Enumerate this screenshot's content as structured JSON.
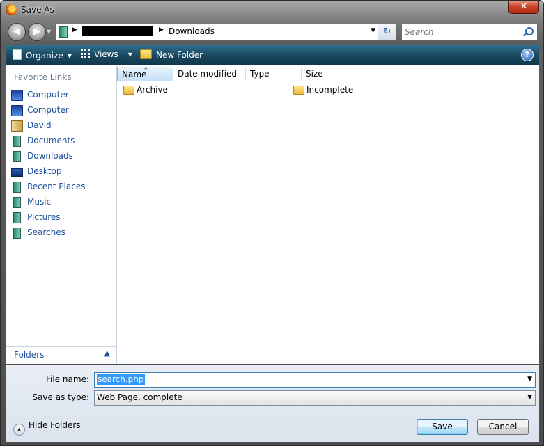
{
  "window": {
    "title": "Save As",
    "close_glyph": "✕"
  },
  "address_bar": {
    "current_folder": "Downloads"
  },
  "search": {
    "placeholder": "Search"
  },
  "toolbar": {
    "organize": "Organize",
    "views": "Views",
    "new_folder": "New Folder"
  },
  "left_pane": {
    "heading": "Favorite Links",
    "items": [
      {
        "label": "Computer",
        "icon": "computer-icon"
      },
      {
        "label": "Computer",
        "icon": "computer-icon"
      },
      {
        "label": "David",
        "icon": "user-folder-icon"
      },
      {
        "label": "Documents",
        "icon": "documents-icon"
      },
      {
        "label": "Downloads",
        "icon": "downloads-icon"
      },
      {
        "label": "Desktop",
        "icon": "desktop-icon"
      },
      {
        "label": "Recent Places",
        "icon": "recent-places-icon"
      },
      {
        "label": "Music",
        "icon": "music-icon"
      },
      {
        "label": "Pictures",
        "icon": "pictures-icon"
      },
      {
        "label": "Searches",
        "icon": "searches-icon"
      }
    ],
    "folders_label": "Folders"
  },
  "columns": {
    "name": "Name",
    "date_modified": "Date modified",
    "type": "Type",
    "size": "Size"
  },
  "files": [
    {
      "name": "Archive",
      "icon": "folder-icon"
    },
    {
      "name": "Incomplete",
      "icon": "folder-icon"
    }
  ],
  "form": {
    "file_name_label": "File name:",
    "file_name_value": "search.php",
    "save_as_type_label": "Save as type:",
    "save_as_type_value": "Web Page, complete"
  },
  "footer": {
    "hide_folders": "Hide Folders",
    "save": "Save",
    "cancel": "Cancel"
  },
  "colors": {
    "accent": "#1c4f9c",
    "toolbar": "#1b4a63",
    "selection": "#3399ff"
  }
}
